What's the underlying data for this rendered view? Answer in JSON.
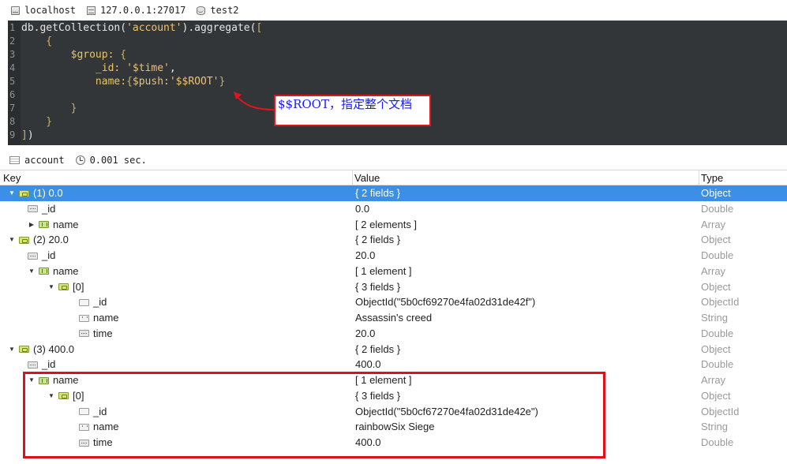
{
  "connection": {
    "host": "localhost",
    "server": "127.0.0.1:27017",
    "database": "test2"
  },
  "editor": {
    "lines": [
      {
        "n": "1",
        "parts": [
          [
            "c-plain",
            "db.getCollection("
          ],
          [
            "c-str",
            "'account'"
          ],
          [
            "c-plain",
            ").aggregate("
          ],
          [
            "c-brk",
            "["
          ]
        ]
      },
      {
        "n": "2",
        "parts": [
          [
            "c-brk",
            "    {"
          ]
        ]
      },
      {
        "n": "3",
        "parts": [
          [
            "c-key",
            "        $group: "
          ],
          [
            "c-brk",
            "{"
          ]
        ]
      },
      {
        "n": "4",
        "parts": [
          [
            "c-key",
            "            _id: "
          ],
          [
            "c-str",
            "'$time'"
          ],
          [
            "c-plain",
            ","
          ]
        ]
      },
      {
        "n": "5",
        "parts": [
          [
            "c-key",
            "            name:"
          ],
          [
            "c-brk",
            "{"
          ],
          [
            "c-key",
            "$push:"
          ],
          [
            "c-str",
            "'$$ROOT'"
          ],
          [
            "c-brk",
            "}"
          ]
        ]
      },
      {
        "n": "6",
        "parts": [
          [
            "c-plain",
            ""
          ]
        ]
      },
      {
        "n": "7",
        "parts": [
          [
            "c-brk",
            "        }"
          ]
        ]
      },
      {
        "n": "8",
        "parts": [
          [
            "c-brk",
            "    }"
          ]
        ]
      },
      {
        "n": "9",
        "parts": [
          [
            "c-brk",
            "]"
          ],
          [
            "c-plain",
            ")"
          ]
        ]
      }
    ]
  },
  "annotation": {
    "text": "$$ROOT，指定整个文档"
  },
  "result": {
    "collection": "account",
    "time": "0.001 sec."
  },
  "tree": {
    "headers": {
      "key": "Key",
      "value": "Value",
      "type": "Type"
    },
    "rows": [
      {
        "depth": 0,
        "toggle": "down",
        "icon": "obj",
        "key": "(1) 0.0",
        "value": "{ 2 fields }",
        "type": "Object",
        "selected": true
      },
      {
        "depth": 1,
        "toggle": "none",
        "icon": "num",
        "key": "_id",
        "value": "0.0",
        "type": "Double"
      },
      {
        "depth": 1,
        "toggle": "right",
        "icon": "arr",
        "key": "name",
        "value": "[ 2 elements ]",
        "type": "Array"
      },
      {
        "depth": 0,
        "toggle": "down",
        "icon": "obj",
        "key": "(2) 20.0",
        "value": "{ 2 fields }",
        "type": "Object"
      },
      {
        "depth": 1,
        "toggle": "none",
        "icon": "num",
        "key": "_id",
        "value": "20.0",
        "type": "Double"
      },
      {
        "depth": 1,
        "toggle": "down",
        "icon": "arr",
        "key": "name",
        "value": "[ 1 element ]",
        "type": "Array"
      },
      {
        "depth": 2,
        "toggle": "down",
        "icon": "obj",
        "key": "[0]",
        "value": "{ 3 fields }",
        "type": "Object"
      },
      {
        "depth": 3,
        "toggle": "none",
        "icon": "oid",
        "key": "_id",
        "value": "ObjectId(\"5b0cf69270e4fa02d31de42f\")",
        "type": "ObjectId"
      },
      {
        "depth": 3,
        "toggle": "none",
        "icon": "str",
        "key": "name",
        "value": "Assassin's creed",
        "type": "String"
      },
      {
        "depth": 3,
        "toggle": "none",
        "icon": "num",
        "key": "time",
        "value": "20.0",
        "type": "Double"
      },
      {
        "depth": 0,
        "toggle": "down",
        "icon": "obj",
        "key": "(3) 400.0",
        "value": "{ 2 fields }",
        "type": "Object"
      },
      {
        "depth": 1,
        "toggle": "none",
        "icon": "num",
        "key": "_id",
        "value": "400.0",
        "type": "Double"
      },
      {
        "depth": 1,
        "toggle": "down",
        "icon": "arr",
        "key": "name",
        "value": "[ 1 element ]",
        "type": "Array"
      },
      {
        "depth": 2,
        "toggle": "down",
        "icon": "obj",
        "key": "[0]",
        "value": "{ 3 fields }",
        "type": "Object"
      },
      {
        "depth": 3,
        "toggle": "none",
        "icon": "oid",
        "key": "_id",
        "value": "ObjectId(\"5b0cf67270e4fa02d31de42e\")",
        "type": "ObjectId"
      },
      {
        "depth": 3,
        "toggle": "none",
        "icon": "str",
        "key": "name",
        "value": "rainbowSix Siege",
        "type": "String"
      },
      {
        "depth": 3,
        "toggle": "none",
        "icon": "num",
        "key": "time",
        "value": "400.0",
        "type": "Double"
      }
    ]
  },
  "colors": {
    "annotation_border": "#e0141b",
    "annotation_text": "#1b1bff",
    "selection": "#3b8fe6",
    "editor_bg": "#323639"
  }
}
